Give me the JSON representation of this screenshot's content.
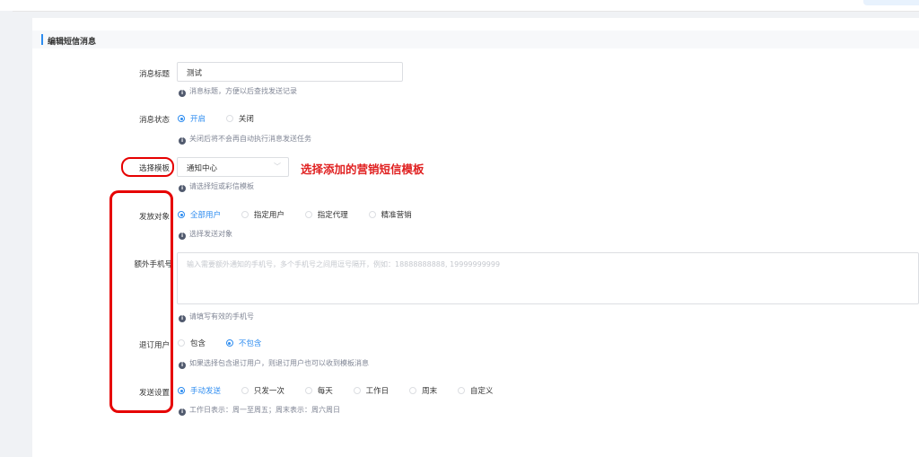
{
  "section": {
    "title": "编辑短信消息"
  },
  "form": {
    "title": {
      "label": "消息标题",
      "value": "测试",
      "hint": "消息标题，方便以后查找发送记录"
    },
    "status": {
      "label": "消息状态",
      "options": [
        "开启",
        "关闭"
      ],
      "selected": "开启",
      "hint": "关闭后将不会再自动执行消息发送任务"
    },
    "template": {
      "label": "选择模板",
      "value": "通知中心",
      "hint": "请选择短或彩信模板"
    },
    "target": {
      "label": "发放对象",
      "options": [
        "全部用户",
        "指定用户",
        "指定代理",
        "精准营销"
      ],
      "selected": "全部用户",
      "hint": "选择发送对象"
    },
    "phones": {
      "label": "额外手机号",
      "placeholder": "输入需要额外通知的手机号，多个手机号之间用逗号隔开，例如：18888888888, 19999999999",
      "hint": "请填写有效的手机号"
    },
    "unsub": {
      "label": "退订用户",
      "options": [
        "包含",
        "不包含"
      ],
      "selected": "不包含",
      "hint": "如果选择包含退订用户，则退订用户也可以收到模板消息"
    },
    "schedule": {
      "label": "发送设置",
      "options": [
        "手动发送",
        "只发一次",
        "每天",
        "工作日",
        "周末",
        "自定义"
      ],
      "selected": "手动发送",
      "hint": "工作日表示：周一至周五；周末表示：周六周日"
    }
  },
  "annotation": {
    "text": "选择添加的营销短信模板"
  },
  "icons": {
    "info": "info-icon",
    "select_arrow": "chevron-down-icon"
  },
  "colors": {
    "primary": "#2d8cf0",
    "annotation_red": "#e60000"
  }
}
